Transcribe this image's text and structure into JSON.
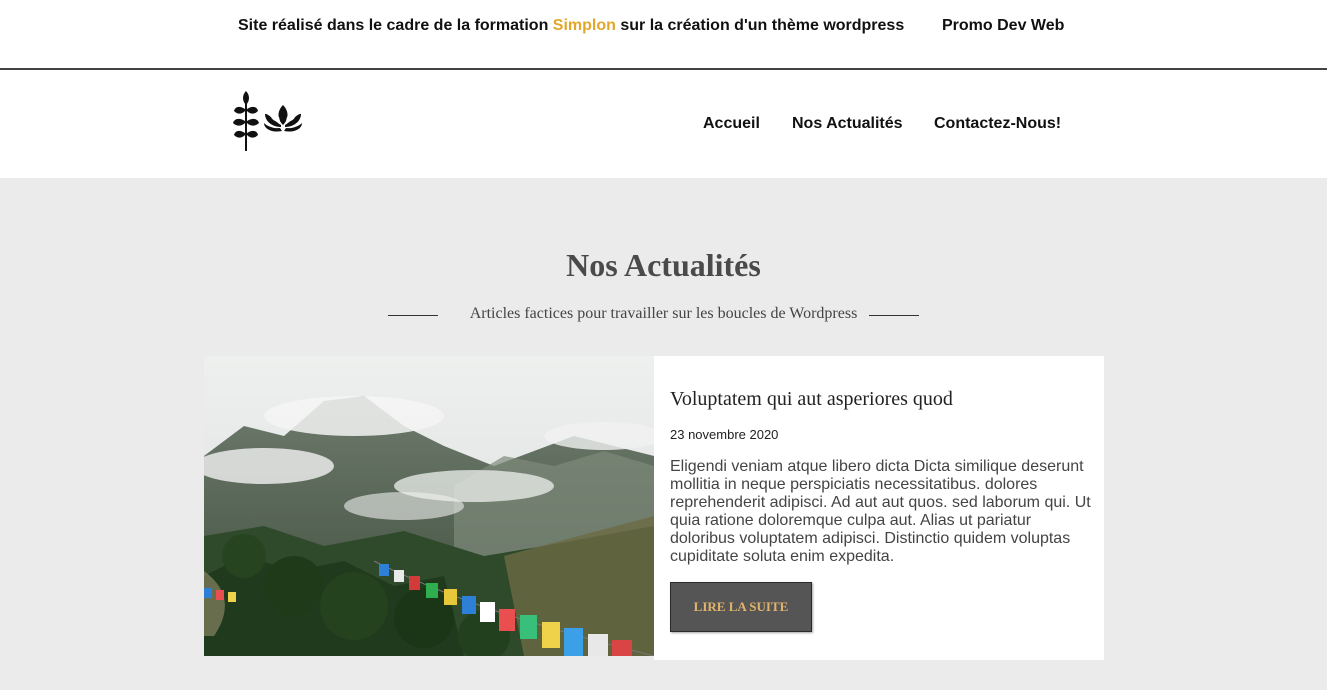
{
  "topbar": {
    "text_before": "Site réalisé dans le cadre de la formation ",
    "highlight": "Simplon",
    "text_after": " sur la création d'un thème wordpress",
    "promo": "Promo Dev Web"
  },
  "header": {
    "logo_icon": "leaf-lotus-logo-icon",
    "nav": [
      "Accueil",
      "Nos Actualités",
      "Contactez-Nous!"
    ]
  },
  "section": {
    "title": "Nos Actualités",
    "subtitle": "Articles factices pour travailler sur les boucles de Wordpress"
  },
  "article": {
    "image": "mountain-landscape-prayer-flags",
    "title": "Voluptatem qui aut asperiores quod",
    "date": "23 novembre 2020",
    "excerpt": "Eligendi veniam atque libero dicta Dicta similique deserunt mollitia in neque perspiciatis necessitatibus. dolores reprehenderit adipisci. Ad aut aut quos. sed laborum qui. Ut quia ratione doloremque culpa aut. Alias ut pariatur doloribus voluptatem adipisci. Distinctio quidem voluptas cupiditate soluta enim expedita.",
    "button": "LIRE LA SUITE"
  },
  "colors": {
    "accent": "#e2a62a",
    "page_bg": "#ebebeb",
    "button_bg": "#555555",
    "button_text": "#e2b46a"
  }
}
